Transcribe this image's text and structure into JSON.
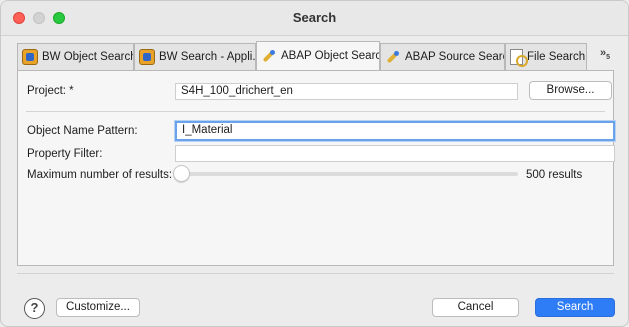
{
  "window": {
    "title": "Search"
  },
  "tabs": [
    {
      "label": "BW Object Search",
      "icon": "bw-icon"
    },
    {
      "label": "BW Search - Appli...",
      "icon": "bw-icon"
    },
    {
      "label": "ABAP Object Search",
      "icon": "abap-icon",
      "active": true
    },
    {
      "label": "ABAP Source Search",
      "icon": "abap-icon"
    },
    {
      "label": "File Search",
      "icon": "file-search-icon"
    }
  ],
  "overflow": {
    "label": "»",
    "count": "5"
  },
  "form": {
    "project_label": "Project: *",
    "project_value": "S4H_100_drichert_en",
    "browse_label": "Browse...",
    "pattern_label": "Object Name Pattern:",
    "pattern_value": "I_Material",
    "property_label": "Property Filter:",
    "property_value": "",
    "max_label": "Maximum number of results:",
    "max_value": "500 results"
  },
  "footer": {
    "help_label": "?",
    "customize_label": "Customize...",
    "cancel_label": "Cancel",
    "search_label": "Search"
  },
  "colors": {
    "accent": "#2f7df6",
    "focus": "#6ba3ea",
    "close": "#fe5f57",
    "maximize": "#28c840"
  }
}
